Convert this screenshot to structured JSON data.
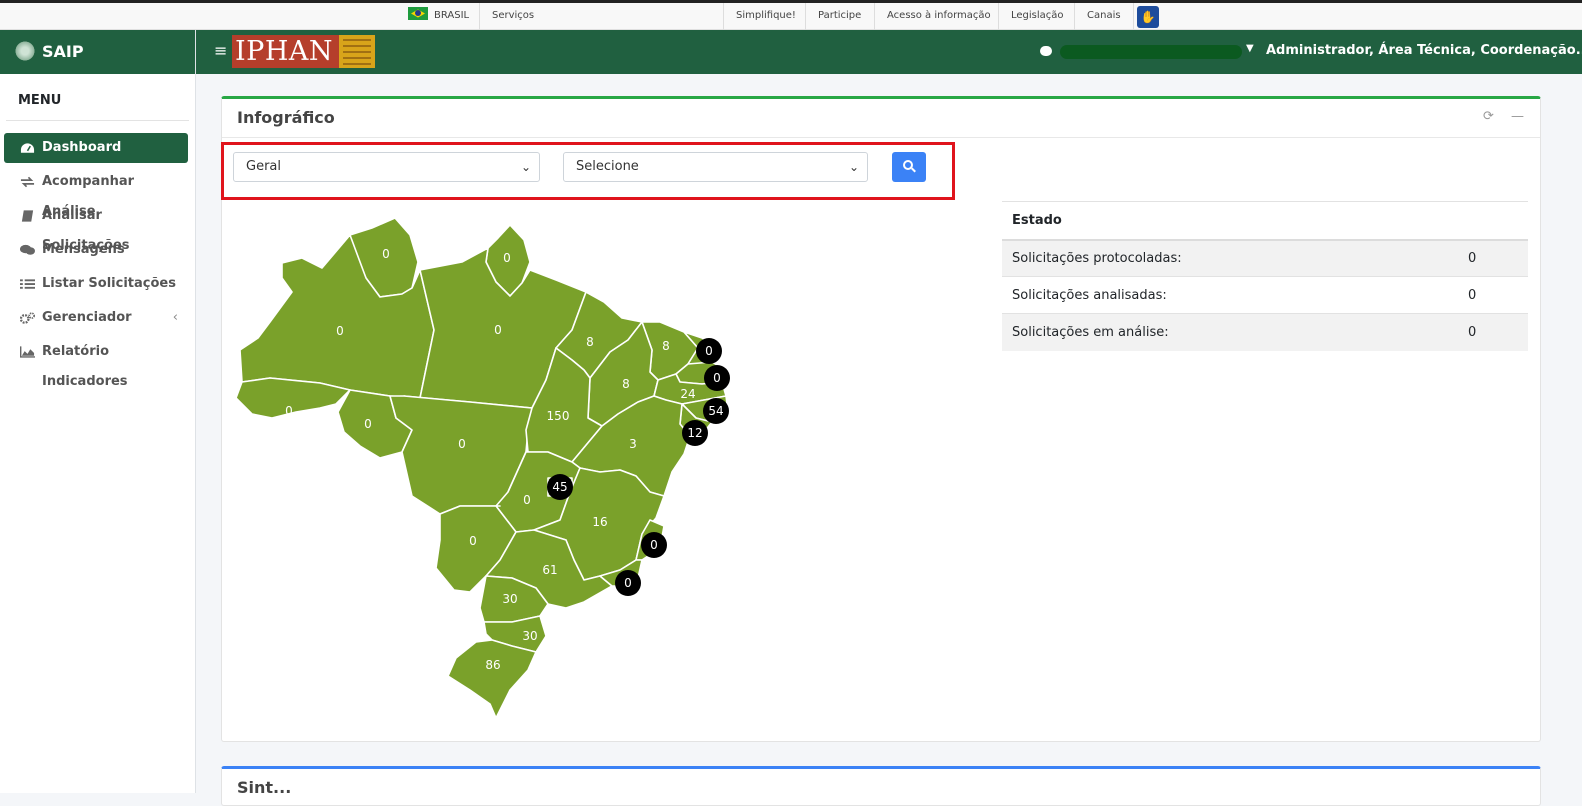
{
  "govbar": {
    "country": "BRASIL",
    "services": "Serviços",
    "links": [
      "Simplifique!",
      "Participe",
      "Acesso à informação",
      "Legislação",
      "Canais"
    ]
  },
  "sidebar": {
    "brand": "SAIP",
    "menu_title": "MENU",
    "items": [
      {
        "label": "Dashboard",
        "icon": "dashboard-icon",
        "active": true
      },
      {
        "label": "Acompanhar Análise",
        "icon": "exchange-icon"
      },
      {
        "label": "Analisar Solicitações",
        "icon": "book-icon"
      },
      {
        "label": "Mensagens",
        "icon": "comments-icon"
      },
      {
        "label": "Listar Solicitações",
        "icon": "list-icon"
      },
      {
        "label": "Gerenciador",
        "icon": "cogs-icon",
        "caret": "‹"
      },
      {
        "label": "Relatório Indicadores",
        "icon": "area-chart-icon"
      }
    ]
  },
  "topbar": {
    "logo_text": "IPHAN",
    "user": "Administrador, Área Técnica, Coordenação..."
  },
  "infografico": {
    "title": "Infográfico",
    "filter1": "Geral",
    "filter2": "Selecione",
    "table": {
      "header": "Estado",
      "rows": [
        {
          "label": "Solicitações protocoladas:",
          "value": "0"
        },
        {
          "label": "Solicitações analisadas:",
          "value": "0"
        },
        {
          "label": "Solicitações em análise:",
          "value": "0"
        }
      ]
    },
    "map_values": {
      "RR": "0",
      "AP": "0",
      "AM": "0",
      "PA": "0",
      "MA": "8",
      "CE": "8",
      "PI": "8",
      "RN": "0",
      "PB": "0",
      "PE": "24",
      "AL": "54",
      "SE": "12",
      "AC": "0",
      "RO": "0",
      "MT": "0",
      "TO": "150",
      "BA": "3",
      "DF": "45",
      "GO": "0",
      "MG": "16",
      "ES": "0",
      "MS": "0",
      "SP": "61",
      "RJ": "0",
      "PR": "30",
      "SC": "30",
      "RS": "86"
    },
    "map_color": "#7aa12a"
  },
  "card2": {
    "title": "Sint..."
  }
}
